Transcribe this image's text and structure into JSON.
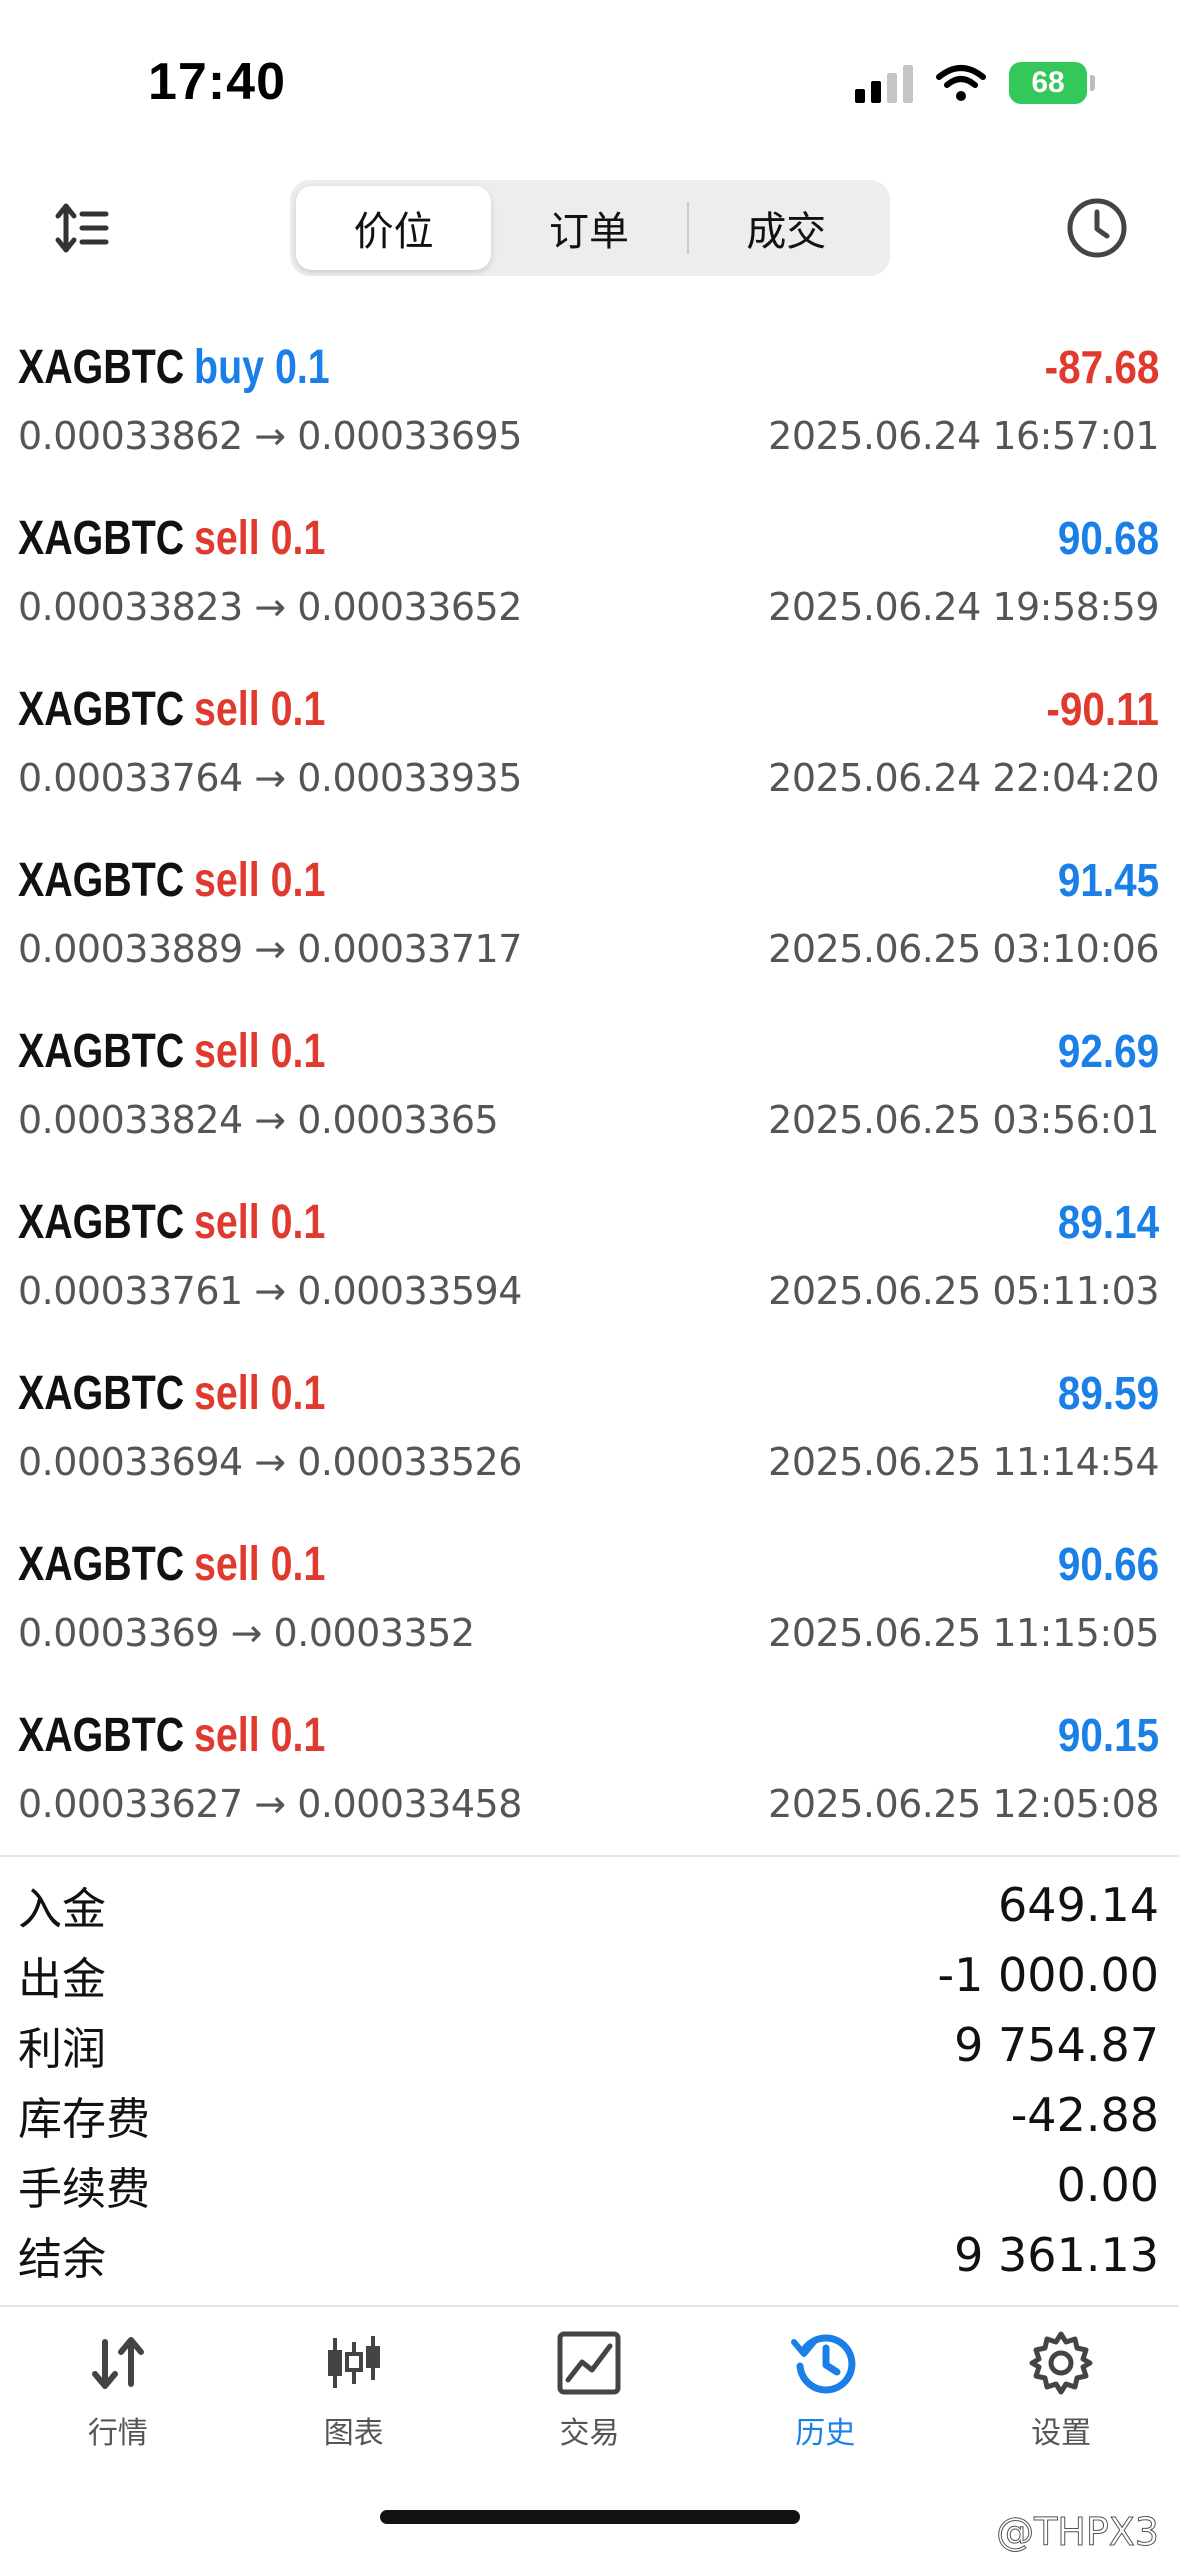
{
  "status_bar": {
    "time": "17:40",
    "battery": "68"
  },
  "segmented": {
    "items": [
      "价位",
      "订单",
      "成交"
    ],
    "active_index": 0
  },
  "deals": [
    {
      "symbol": "XAGBTC",
      "side": "buy",
      "volume": "0.1",
      "profit": "-87.68",
      "open": "0.00033862",
      "close": "0.00033695",
      "time": "2025.06.24 16:57:01"
    },
    {
      "symbol": "XAGBTC",
      "side": "sell",
      "volume": "0.1",
      "profit": "90.68",
      "open": "0.00033823",
      "close": "0.00033652",
      "time": "2025.06.24 19:58:59"
    },
    {
      "symbol": "XAGBTC",
      "side": "sell",
      "volume": "0.1",
      "profit": "-90.11",
      "open": "0.00033764",
      "close": "0.00033935",
      "time": "2025.06.24 22:04:20"
    },
    {
      "symbol": "XAGBTC",
      "side": "sell",
      "volume": "0.1",
      "profit": "91.45",
      "open": "0.00033889",
      "close": "0.00033717",
      "time": "2025.06.25 03:10:06"
    },
    {
      "symbol": "XAGBTC",
      "side": "sell",
      "volume": "0.1",
      "profit": "92.69",
      "open": "0.00033824",
      "close": "0.0003365",
      "time": "2025.06.25 03:56:01"
    },
    {
      "symbol": "XAGBTC",
      "side": "sell",
      "volume": "0.1",
      "profit": "89.14",
      "open": "0.00033761",
      "close": "0.00033594",
      "time": "2025.06.25 05:11:03"
    },
    {
      "symbol": "XAGBTC",
      "side": "sell",
      "volume": "0.1",
      "profit": "89.59",
      "open": "0.00033694",
      "close": "0.00033526",
      "time": "2025.06.25 11:14:54"
    },
    {
      "symbol": "XAGBTC",
      "side": "sell",
      "volume": "0.1",
      "profit": "90.66",
      "open": "0.0003369",
      "close": "0.0003352",
      "time": "2025.06.25 11:15:05"
    },
    {
      "symbol": "XAGBTC",
      "side": "sell",
      "volume": "0.1",
      "profit": "90.15",
      "open": "0.00033627",
      "close": "0.00033458",
      "time": "2025.06.25 12:05:08"
    }
  ],
  "arrow": "→",
  "summary": [
    {
      "label": "入金",
      "value": "649.14"
    },
    {
      "label": "出金",
      "value": "-1 000.00"
    },
    {
      "label": "利润",
      "value": "9 754.87"
    },
    {
      "label": "库存费",
      "value": "-42.88"
    },
    {
      "label": "手续费",
      "value": "0.00"
    },
    {
      "label": "结余",
      "value": "9 361.13"
    }
  ],
  "tabbar": {
    "items": [
      {
        "label": "行情",
        "icon": "quotes-arrows-icon"
      },
      {
        "label": "图表",
        "icon": "candlestick-chart-icon"
      },
      {
        "label": "交易",
        "icon": "trade-chart-icon"
      },
      {
        "label": "历史",
        "icon": "history-clock-icon"
      },
      {
        "label": "设置",
        "icon": "gear-icon"
      }
    ],
    "active_index": 3
  },
  "colors": {
    "accent": "#1a7fe6",
    "loss": "#e03a2e",
    "battery": "#34c759"
  },
  "watermark": "@THPX3"
}
